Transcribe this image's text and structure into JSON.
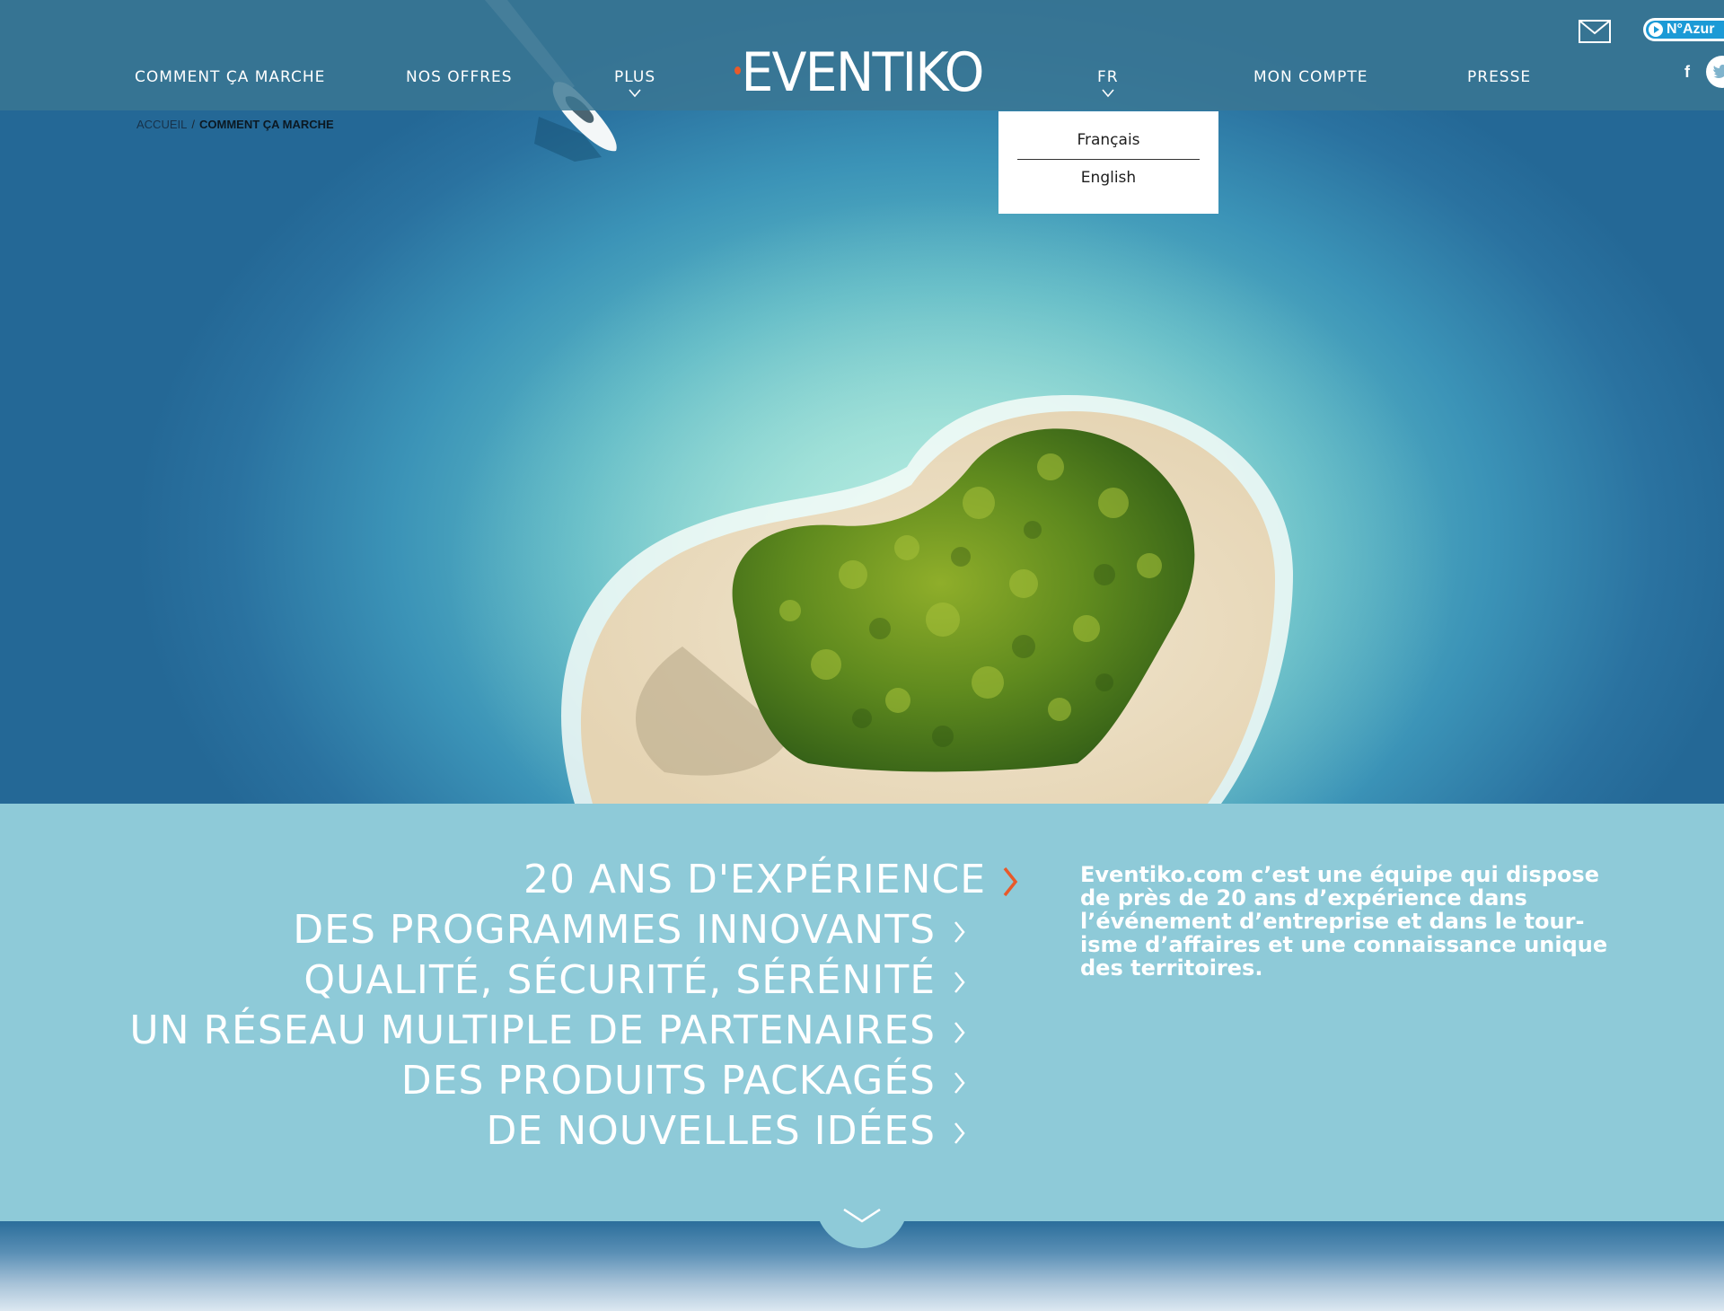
{
  "nav": {
    "left": [
      {
        "label": "COMMENT ÇA MARCHE"
      },
      {
        "label": "NOS OFFRES"
      },
      {
        "label": "PLUS"
      }
    ],
    "right": [
      {
        "label": "FR"
      },
      {
        "label": "MON COMPTE"
      },
      {
        "label": "PRESSE"
      }
    ],
    "logo": "EVENTIKO",
    "azur_label": "N°Azur",
    "facebook_glyph": "f"
  },
  "breadcrumb": {
    "home": "ACCUEIL",
    "separator": "/",
    "current": "COMMENT ÇA MARCHE"
  },
  "lang_menu": {
    "options": [
      "Français",
      "English"
    ]
  },
  "features": [
    "20 ANS D'EXPÉRIENCE",
    "DES PROGRAMMES INNOVANTS",
    "QUALITÉ, SÉCURITÉ, SÉRÉNITÉ",
    "UN RÉSEAU MULTIPLE DE PARTENAIRES",
    "DES PRODUITS PACKAGÉS",
    "DE NOUVELLES IDÉES"
  ],
  "description": "Eventiko.com c’est une équipe qui dispose de près de 20 ans d’expérience dans l’événement d’entreprise et dans le tour-isme d’affaires et une connaissance unique des territoires.",
  "colors": {
    "accent": "#e85a2a",
    "panel": "#8ecad8",
    "topbar": "#3a7692",
    "azur": "#1c9ad6"
  },
  "icons": {
    "mail": "mail-icon",
    "facebook": "facebook-icon",
    "twitter": "twitter-icon",
    "scroll": "chevron-down-icon",
    "play": "play-icon"
  }
}
